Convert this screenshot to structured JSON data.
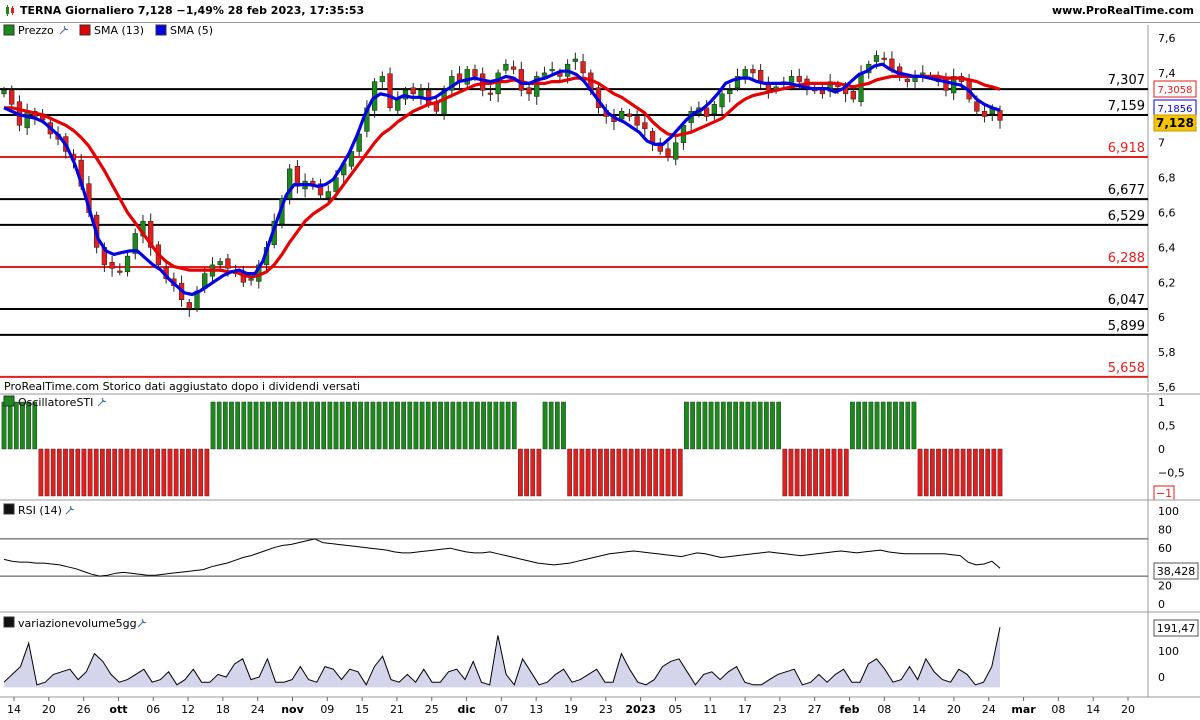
{
  "header": {
    "title": "TERNA Giornaliero 7,128 −1,49% 28 feb 2023, 17:35:53",
    "brand": "www.ProRealTime.com"
  },
  "legend": [
    {
      "label": "Prezzo",
      "color": "#1a8a1a",
      "icon": "wrench-icon"
    },
    {
      "label": "SMA (13)",
      "color": "#e30000",
      "icon": ""
    },
    {
      "label": "SMA (5)",
      "color": "#0000e0",
      "icon": ""
    }
  ],
  "notice": "ProRealTime.com  Storico dati aggiustato dopo i dividendi versati",
  "colors": {
    "up": "#1a8a1a",
    "down": "#e31e1e",
    "sma13": "#e30000",
    "sma5": "#0000e0"
  },
  "x_axis": {
    "labels": [
      "14",
      "20",
      "26",
      "ott",
      "06",
      "12",
      "18",
      "24",
      "nov",
      "09",
      "15",
      "21",
      "25",
      "dic",
      "07",
      "13",
      "19",
      "23",
      "2023",
      "05",
      "11",
      "17",
      "23",
      "27",
      "feb",
      "08",
      "14",
      "20",
      "24",
      "mar",
      "08",
      "14",
      "20"
    ],
    "bold": [
      "ott",
      "nov",
      "dic",
      "2023",
      "feb",
      "mar"
    ]
  },
  "chart_data": [
    {
      "type": "candlestick",
      "title": "TERNA Giornaliero",
      "y_ticks": [
        "7,6",
        "7,4",
        "7,2",
        "7",
        "6,8",
        "6,6",
        "6,4",
        "6,2",
        "6",
        "5,8",
        "5,6"
      ],
      "levels": [
        {
          "value": 7.307,
          "label": "7,307",
          "color": "black"
        },
        {
          "value": 7.159,
          "label": "7,159",
          "color": "black"
        },
        {
          "value": 6.918,
          "label": "6,918",
          "color": "red"
        },
        {
          "value": 6.677,
          "label": "6,677",
          "color": "black"
        },
        {
          "value": 6.529,
          "label": "6,529",
          "color": "black"
        },
        {
          "value": 6.288,
          "label": "6,288",
          "color": "red"
        },
        {
          "value": 6.047,
          "label": "6,047",
          "color": "black"
        },
        {
          "value": 5.899,
          "label": "5,899",
          "color": "black"
        },
        {
          "value": 5.658,
          "label": "5,658",
          "color": "red"
        }
      ],
      "last_values": [
        {
          "label": "7,3058",
          "value": 7.3058,
          "series": "SMA (13)"
        },
        {
          "label": "7,1856",
          "value": 7.1856,
          "series": "SMA (5)"
        },
        {
          "label": "7,128",
          "value": 7.128,
          "series": "Prezzo"
        }
      ],
      "close": [
        7.3,
        7.22,
        7.1,
        7.18,
        7.15,
        7.13,
        7.05,
        7.02,
        6.95,
        6.9,
        6.75,
        6.6,
        6.4,
        6.3,
        6.28,
        6.26,
        6.35,
        6.48,
        6.55,
        6.4,
        6.3,
        6.22,
        6.18,
        6.1,
        6.05,
        6.15,
        6.25,
        6.3,
        6.32,
        6.28,
        6.25,
        6.2,
        6.22,
        6.3,
        6.4,
        6.55,
        6.68,
        6.85,
        6.75,
        6.78,
        6.75,
        6.7,
        6.72,
        6.8,
        6.88,
        6.95,
        7.05,
        7.2,
        7.35,
        7.38,
        7.2,
        7.25,
        7.3,
        7.28,
        7.3,
        7.22,
        7.18,
        7.3,
        7.38,
        7.35,
        7.42,
        7.38,
        7.3,
        7.28,
        7.4,
        7.45,
        7.42,
        7.3,
        7.28,
        7.38,
        7.4,
        7.42,
        7.38,
        7.45,
        7.48,
        7.4,
        7.3,
        7.2,
        7.15,
        7.12,
        7.18,
        7.15,
        7.1,
        7.08,
        7.0,
        6.95,
        6.92,
        7.0,
        7.1,
        7.18,
        7.2,
        7.15,
        7.22,
        7.28,
        7.3,
        7.38,
        7.42,
        7.4,
        7.35,
        7.3,
        7.32,
        7.35,
        7.38,
        7.35,
        7.32,
        7.3,
        7.28,
        7.35,
        7.32,
        7.28,
        7.25,
        7.4,
        7.45,
        7.5,
        7.48,
        7.42,
        7.38,
        7.35,
        7.38,
        7.4,
        7.38,
        7.35,
        7.3,
        7.38,
        7.35,
        7.25,
        7.18,
        7.15,
        7.2,
        7.128
      ],
      "sma13": [
        7.2,
        7.2,
        7.19,
        7.18,
        7.17,
        7.16,
        7.14,
        7.12,
        7.1,
        7.07,
        7.03,
        6.98,
        6.91,
        6.84,
        6.76,
        6.68,
        6.6,
        6.54,
        6.48,
        6.42,
        6.36,
        6.32,
        6.29,
        6.28,
        6.27,
        6.27,
        6.27,
        6.27,
        6.27,
        6.26,
        6.26,
        6.24,
        6.23,
        6.24,
        6.26,
        6.3,
        6.36,
        6.43,
        6.49,
        6.55,
        6.59,
        6.62,
        6.65,
        6.7,
        6.76,
        6.82,
        6.88,
        6.94,
        7.0,
        7.05,
        7.08,
        7.12,
        7.15,
        7.18,
        7.2,
        7.22,
        7.23,
        7.25,
        7.27,
        7.29,
        7.31,
        7.33,
        7.34,
        7.34,
        7.35,
        7.35,
        7.36,
        7.35,
        7.34,
        7.34,
        7.34,
        7.35,
        7.35,
        7.36,
        7.37,
        7.37,
        7.36,
        7.34,
        7.31,
        7.28,
        7.26,
        7.23,
        7.2,
        7.17,
        7.12,
        7.08,
        7.05,
        7.04,
        7.05,
        7.06,
        7.08,
        7.1,
        7.12,
        7.14,
        7.18,
        7.22,
        7.25,
        7.27,
        7.28,
        7.29,
        7.3,
        7.31,
        7.32,
        7.33,
        7.34,
        7.34,
        7.34,
        7.34,
        7.34,
        7.33,
        7.32,
        7.33,
        7.34,
        7.36,
        7.37,
        7.38,
        7.38,
        7.38,
        7.38,
        7.38,
        7.38,
        7.38,
        7.37,
        7.37,
        7.37,
        7.36,
        7.35,
        7.33,
        7.32,
        7.3058
      ],
      "sma5": [
        7.2,
        7.18,
        7.16,
        7.15,
        7.14,
        7.12,
        7.08,
        7.04,
        6.98,
        6.88,
        6.75,
        6.6,
        6.45,
        6.38,
        6.36,
        6.37,
        6.38,
        6.38,
        6.34,
        6.3,
        6.27,
        6.22,
        6.18,
        6.14,
        6.13,
        6.15,
        6.18,
        6.21,
        6.24,
        6.26,
        6.27,
        6.25,
        6.25,
        6.32,
        6.45,
        6.58,
        6.7,
        6.76,
        6.76,
        6.76,
        6.75,
        6.76,
        6.79,
        6.86,
        6.94,
        7.04,
        7.16,
        7.25,
        7.28,
        7.27,
        7.25,
        7.27,
        7.26,
        7.26,
        7.25,
        7.26,
        7.29,
        7.32,
        7.35,
        7.36,
        7.37,
        7.36,
        7.35,
        7.36,
        7.38,
        7.37,
        7.34,
        7.34,
        7.36,
        7.37,
        7.39,
        7.41,
        7.41,
        7.39,
        7.35,
        7.29,
        7.23,
        7.17,
        7.14,
        7.12,
        7.09,
        7.06,
        7.01,
        6.99,
        6.99,
        7.03,
        7.08,
        7.13,
        7.17,
        7.19,
        7.23,
        7.28,
        7.34,
        7.36,
        7.37,
        7.37,
        7.35,
        7.34,
        7.34,
        7.34,
        7.34,
        7.33,
        7.32,
        7.31,
        7.31,
        7.31,
        7.29,
        7.31,
        7.35,
        7.39,
        7.41,
        7.44,
        7.45,
        7.42,
        7.4,
        7.39,
        7.38,
        7.38,
        7.37,
        7.36,
        7.35,
        7.34,
        7.33,
        7.3,
        7.25,
        7.22,
        7.2,
        7.1856
      ]
    },
    {
      "type": "bar",
      "title": "OscillatoreSTI",
      "y_ticks": [
        "1",
        "0,5",
        "0",
        "−0,5"
      ],
      "last_value": "−1",
      "values": [
        1,
        1,
        1,
        1,
        1,
        1,
        -1,
        -1,
        -1,
        -1,
        -1,
        -1,
        -1,
        -1,
        -1,
        -1,
        -1,
        -1,
        -1,
        -1,
        -1,
        -1,
        -1,
        -1,
        -1,
        -1,
        -1,
        -1,
        -1,
        -1,
        -1,
        -1,
        -1,
        -1,
        1,
        1,
        1,
        1,
        1,
        1,
        1,
        1,
        1,
        1,
        1,
        1,
        1,
        1,
        1,
        1,
        1,
        1,
        1,
        1,
        1,
        1,
        1,
        1,
        1,
        1,
        1,
        1,
        1,
        1,
        1,
        1,
        1,
        1,
        1,
        1,
        1,
        1,
        1,
        1,
        1,
        1,
        1,
        1,
        1,
        1,
        1,
        1,
        1,
        1,
        -1,
        -1,
        -1,
        -1,
        1,
        1,
        1,
        1,
        -1,
        -1,
        -1,
        -1,
        -1,
        -1,
        -1,
        -1,
        -1,
        -1,
        -1,
        -1,
        -1,
        -1,
        -1,
        -1,
        -1,
        -1,
        -1,
        1,
        1,
        1,
        1,
        1,
        1,
        1,
        1,
        1,
        1,
        1,
        1,
        1,
        1,
        1,
        1,
        -1,
        -1,
        -1,
        -1,
        -1,
        -1,
        -1,
        -1,
        -1,
        -1,
        -1,
        1,
        1,
        1,
        1,
        1,
        1,
        1,
        1,
        1,
        1,
        1,
        -1,
        -1,
        -1,
        -1,
        -1,
        -1,
        -1,
        -1,
        -1,
        -1,
        -1,
        -1,
        -1,
        -1
      ]
    },
    {
      "type": "line",
      "title": "RSI (14)",
      "y_ticks": [
        "100",
        "80",
        "60",
        "40",
        "20",
        "0"
      ],
      "ylim": [
        0,
        100
      ],
      "levels": [
        70,
        30
      ],
      "last_value": "38,428",
      "values": [
        48,
        46,
        45,
        45,
        44,
        44,
        43,
        42,
        40,
        38,
        35,
        32,
        30,
        31,
        33,
        34,
        33,
        32,
        31,
        31,
        32,
        33,
        34,
        35,
        36,
        37,
        40,
        42,
        44,
        47,
        50,
        52,
        55,
        58,
        61,
        63,
        64,
        66,
        68,
        70,
        66,
        65,
        64,
        63,
        62,
        61,
        60,
        59,
        58,
        56,
        55,
        55,
        56,
        57,
        58,
        59,
        60,
        58,
        56,
        55,
        55,
        56,
        54,
        52,
        50,
        48,
        46,
        44,
        43,
        42,
        43,
        44,
        46,
        48,
        50,
        52,
        54,
        55,
        56,
        57,
        56,
        55,
        54,
        53,
        52,
        51,
        53,
        55,
        54,
        52,
        50,
        51,
        52,
        53,
        54,
        55,
        56,
        55,
        54,
        53,
        52,
        53,
        54,
        55,
        56,
        57,
        56,
        55,
        56,
        57,
        58,
        56,
        55,
        54,
        54,
        54,
        54,
        54,
        54,
        53,
        52,
        45,
        42,
        43,
        46,
        38.428
      ]
    },
    {
      "type": "area",
      "title": "variazionevolume5gg",
      "y_ticks": [
        "100",
        "0"
      ],
      "last_value": "191,47",
      "values": [
        -20,
        10,
        40,
        130,
        -30,
        -20,
        10,
        20,
        30,
        -10,
        20,
        90,
        60,
        10,
        -20,
        -10,
        10,
        30,
        -20,
        -10,
        20,
        -30,
        -10,
        30,
        -20,
        -20,
        10,
        0,
        50,
        70,
        -10,
        0,
        70,
        -20,
        -20,
        -10,
        40,
        -10,
        -20,
        40,
        30,
        -10,
        30,
        20,
        -30,
        40,
        80,
        -10,
        -20,
        10,
        -20,
        30,
        -20,
        -20,
        20,
        30,
        -10,
        60,
        -20,
        -30,
        160,
        10,
        -30,
        70,
        20,
        -30,
        -20,
        10,
        30,
        -20,
        -10,
        10,
        30,
        -20,
        -20,
        90,
        30,
        -20,
        -30,
        -10,
        40,
        60,
        70,
        20,
        -30,
        10,
        20,
        -10,
        20,
        40,
        -20,
        -30,
        -30,
        -10,
        10,
        20,
        30,
        -30,
        -20,
        10,
        -20,
        10,
        30,
        -20,
        -20,
        50,
        70,
        30,
        -20,
        -10,
        40,
        -10,
        70,
        20,
        -10,
        -20,
        30,
        10,
        -30,
        -20,
        40,
        191.47
      ]
    }
  ]
}
